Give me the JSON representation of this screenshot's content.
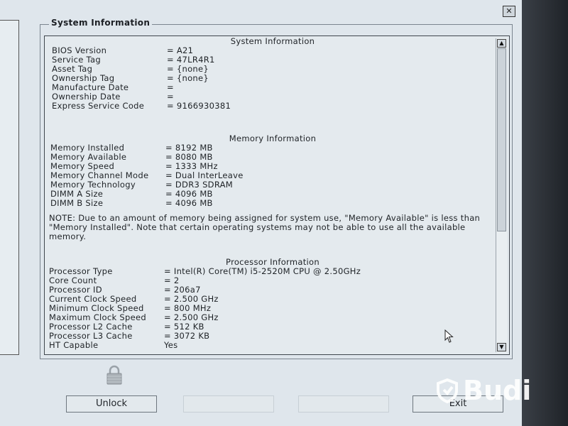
{
  "window": {
    "close_label": "✕"
  },
  "groupbox": {
    "title": "System Information"
  },
  "system": {
    "title": "System Information",
    "rows": [
      {
        "label": "BIOS Version",
        "value": "= A21"
      },
      {
        "label": "Service Tag",
        "value": "= 47LR4R1"
      },
      {
        "label": "Asset Tag",
        "value": "= {none}"
      },
      {
        "label": "Ownership Tag",
        "value": "= {none}"
      },
      {
        "label": "Manufacture Date",
        "value": "="
      },
      {
        "label": "Ownership Date",
        "value": "="
      },
      {
        "label": "Express Service Code",
        "value": "= 9166930381"
      }
    ]
  },
  "memory": {
    "title": "Memory Information",
    "rows": [
      {
        "label": "Memory Installed",
        "value": "= 8192 MB"
      },
      {
        "label": "Memory Available",
        "value": "= 8080 MB"
      },
      {
        "label": "Memory Speed",
        "value": "= 1333 MHz"
      },
      {
        "label": "Memory Channel Mode",
        "value": "= Dual InterLeave"
      },
      {
        "label": "Memory Technology",
        "value": "= DDR3 SDRAM"
      },
      {
        "label": "DIMM A Size",
        "value": "= 4096 MB"
      },
      {
        "label": "DIMM B Size",
        "value": "= 4096 MB"
      }
    ],
    "note": "NOTE: Due to an amount of memory being assigned for system use, \"Memory Available\" is less than \"Memory Installed\". Note that certain operating systems may not be able to use all the available memory."
  },
  "processor": {
    "title": "Processor Information",
    "rows": [
      {
        "label": "Processor Type",
        "value": "= Intel(R) Core(TM) i5-2520M CPU @ 2.50GHz"
      },
      {
        "label": "Core Count",
        "value": "= 2"
      },
      {
        "label": "Processor ID",
        "value": "= 206a7"
      },
      {
        "label": "Current Clock Speed",
        "value": "= 2.500 GHz"
      },
      {
        "label": "Minimum Clock Speed",
        "value": "= 800 MHz"
      },
      {
        "label": "Maximum Clock Speed",
        "value": "= 2.500 GHz"
      },
      {
        "label": "Processor L2 Cache",
        "value": "= 512 KB"
      },
      {
        "label": "Processor L3 Cache",
        "value": "= 3072 KB"
      },
      {
        "label": "HT Capable",
        "value": "Yes"
      }
    ]
  },
  "scrollbar": {
    "up_icon": "▲",
    "down_icon": "▼"
  },
  "buttons": {
    "unlock": "Unlock",
    "exit": "Exit"
  },
  "watermark": {
    "text": "Budi"
  }
}
